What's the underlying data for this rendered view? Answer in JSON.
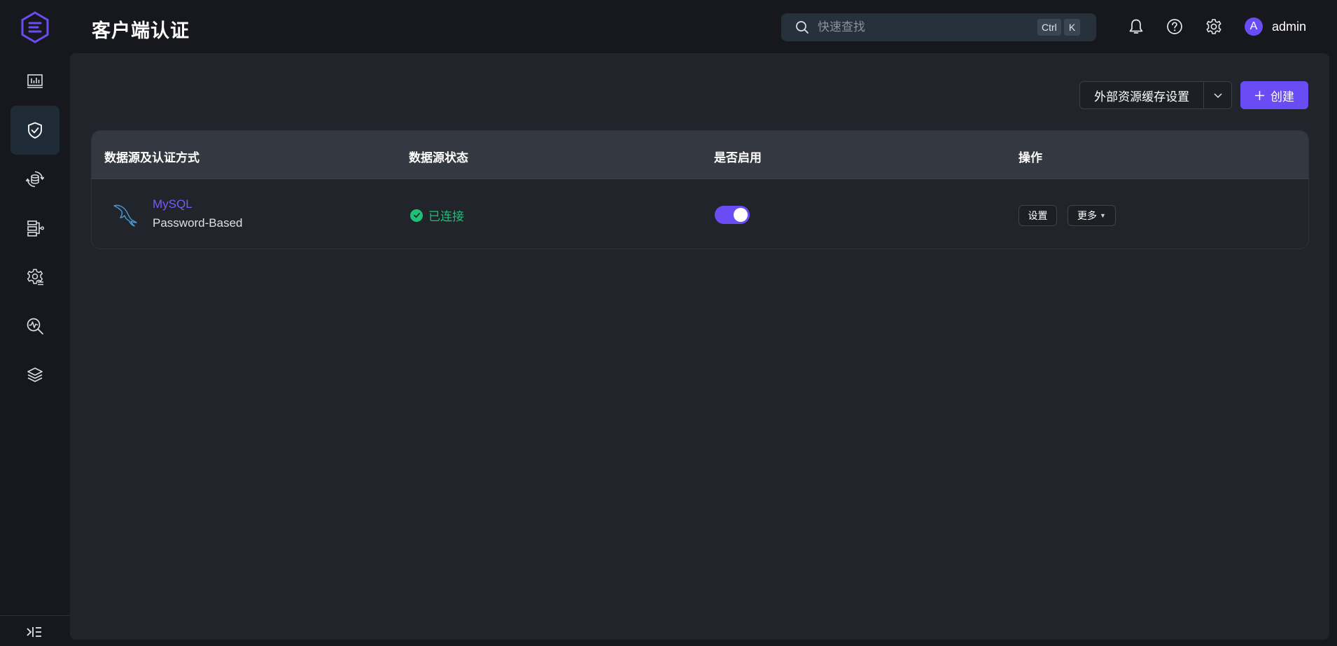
{
  "header": {
    "title": "客户端认证",
    "search_placeholder": "快速查找",
    "shortcut_ctrl": "Ctrl",
    "shortcut_k": "K",
    "user_initial": "A",
    "username": "admin"
  },
  "sidebar": {
    "items": [
      {
        "name": "dashboard",
        "icon": "chart-icon"
      },
      {
        "name": "access-control",
        "icon": "shield-check-icon",
        "active": true
      },
      {
        "name": "sync",
        "icon": "database-sync-icon"
      },
      {
        "name": "data-integration",
        "icon": "flow-icon"
      },
      {
        "name": "management",
        "icon": "gear-icon"
      },
      {
        "name": "diagnose",
        "icon": "search-pulse-icon"
      },
      {
        "name": "extensions",
        "icon": "layers-icon"
      }
    ]
  },
  "toolbar": {
    "external_cache_label": "外部资源缓存设置",
    "create_label": "创建"
  },
  "table": {
    "columns": [
      "数据源及认证方式",
      "数据源状态",
      "是否启用",
      "操作"
    ],
    "rows": [
      {
        "datasource": "MySQL",
        "auth_method": "Password-Based",
        "status": "已连接",
        "enabled": true,
        "settings_label": "设置",
        "more_label": "更多"
      }
    ]
  },
  "colors": {
    "accent": "#6a4cf5",
    "success": "#1fbf75",
    "background": "#16181d",
    "panel": "#21242a"
  }
}
